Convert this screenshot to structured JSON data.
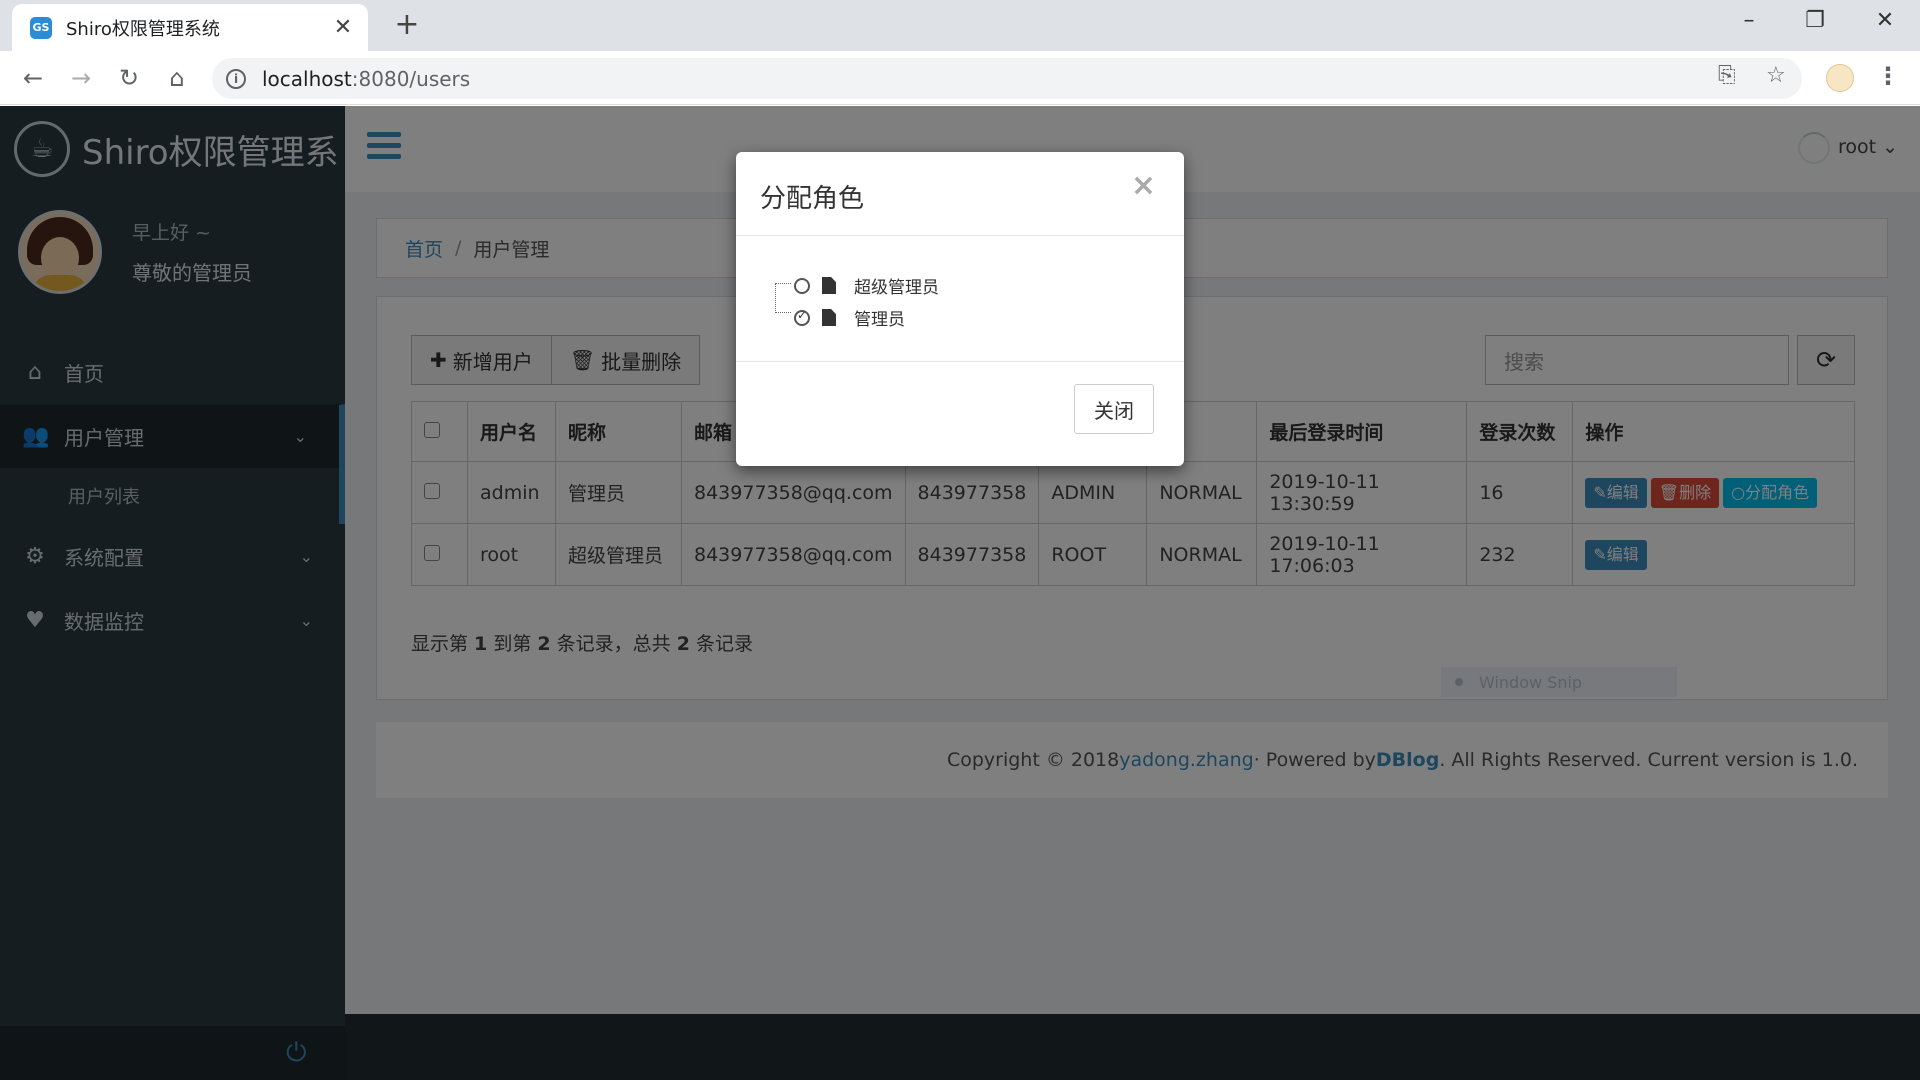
{
  "browser": {
    "tab_title": "Shiro权限管理系统",
    "favicon_text": "GS",
    "url_host": "localhost",
    "url_rest": ":8080/users",
    "win_min": "–",
    "win_max": "❐",
    "win_close": "✕"
  },
  "sidebar": {
    "logo_text": "Shiro权限管理系",
    "greeting": "早上好 ~",
    "user_title": "尊敬的管理员",
    "items": [
      {
        "label": "首页",
        "icon": "home-icon"
      },
      {
        "label": "用户管理",
        "icon": "users-icon"
      },
      {
        "label": "用户列表",
        "icon": ""
      },
      {
        "label": "系统配置",
        "icon": "gears-icon"
      },
      {
        "label": "数据监控",
        "icon": "heartbeat-icon"
      }
    ]
  },
  "topbar": {
    "user": "root ⌄"
  },
  "breadcrumb": {
    "home": "首页",
    "current": "用户管理"
  },
  "toolbar": {
    "add_label": "新增用户",
    "batch_delete_label": "批量删除",
    "search_placeholder": "搜索"
  },
  "table": {
    "headers": [
      "用户名",
      "昵称",
      "邮箱",
      "",
      "",
      "",
      "最后登录时间",
      "登录次数",
      "操作"
    ],
    "rows": [
      {
        "username": "admin",
        "nickname": "管理员",
        "email": "843977358@qq.com",
        "qq": "843977358",
        "role": "ADMIN",
        "status": "NORMAL",
        "last_login": "2019-10-11 13:30:59",
        "count": "16"
      },
      {
        "username": "root",
        "nickname": "超级管理员",
        "email": "843977358@qq.com",
        "qq": "843977358",
        "role": "ROOT",
        "status": "NORMAL",
        "last_login": "2019-10-11 17:06:03",
        "count": "232"
      }
    ],
    "ops": {
      "edit": "编辑",
      "delete": "删除",
      "assign_role": "分配角色"
    }
  },
  "pagination": {
    "p1": "显示第 ",
    "from": "1",
    "p2": " 到第 ",
    "to": "2",
    "p3": " 条记录，总共 ",
    "total": "2",
    "p4": " 条记录"
  },
  "window_snip": "Window Snip",
  "footer": {
    "prefix": "Copyright © 2018 ",
    "author": "yadong.zhang",
    "mid": " · Powered by ",
    "brand": "DBlog",
    "suffix": ". All Rights Reserved. Current version is 1.0."
  },
  "modal": {
    "title": "分配角色",
    "close_x": "×",
    "roles": [
      {
        "label": "超级管理员",
        "checked": false
      },
      {
        "label": "管理员",
        "checked": true
      }
    ],
    "close_label": "关闭"
  },
  "colors": {
    "accent": "#3c8dbc",
    "danger": "#dd4b39",
    "info": "#00c0ef",
    "sidebar": "#2c3b41"
  }
}
